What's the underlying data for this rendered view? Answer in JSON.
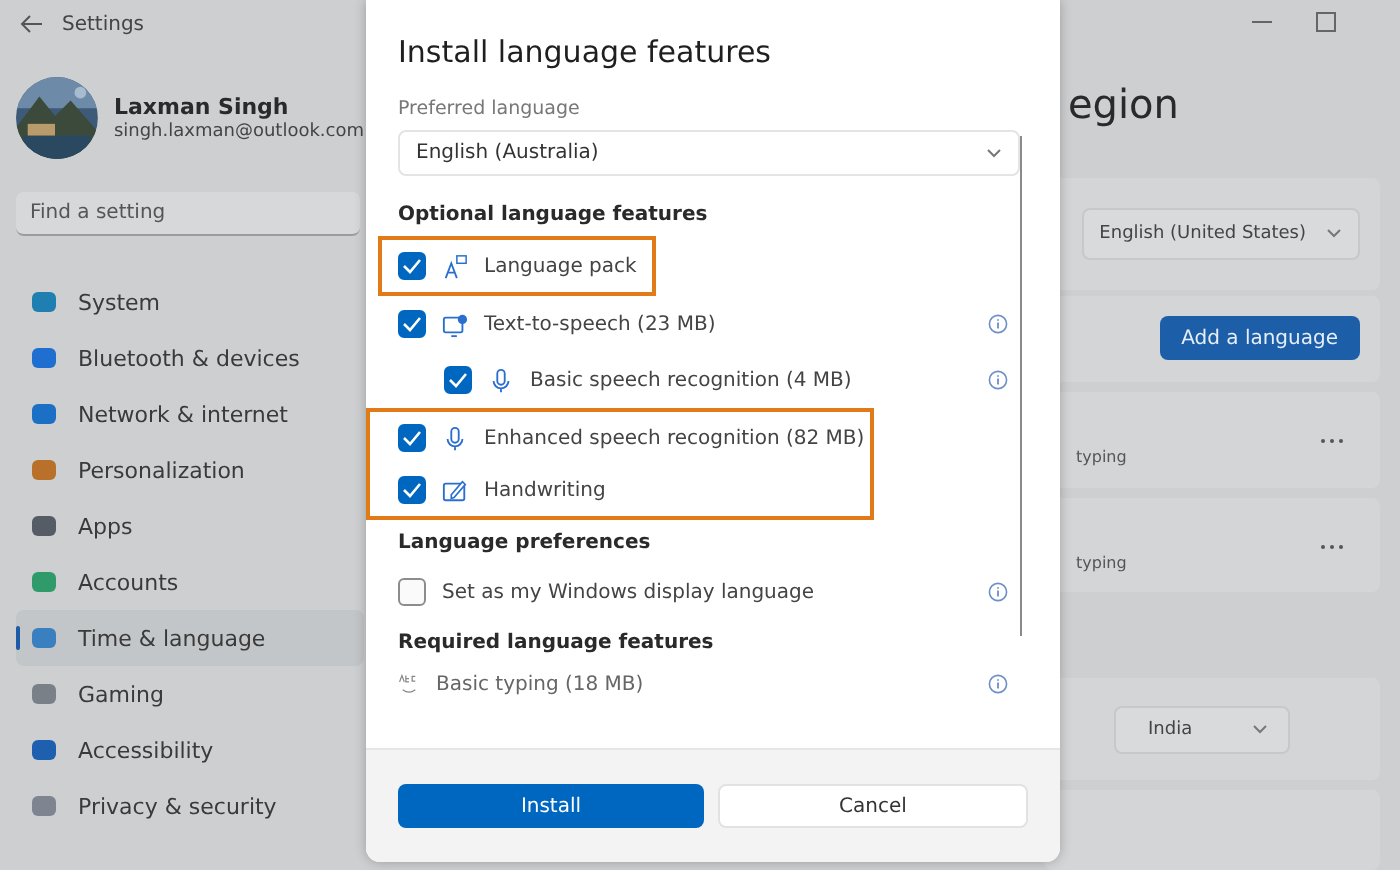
{
  "settings": {
    "title": "Settings",
    "user": {
      "name": "Laxman Singh",
      "email": "singh.laxman@outlook.com"
    },
    "search": {
      "placeholder": "Find a setting"
    },
    "nav": [
      {
        "label": "System",
        "selected": false
      },
      {
        "label": "Bluetooth & devices",
        "selected": false
      },
      {
        "label": "Network & internet",
        "selected": false
      },
      {
        "label": "Personalization",
        "selected": false
      },
      {
        "label": "Apps",
        "selected": false
      },
      {
        "label": "Accounts",
        "selected": false
      },
      {
        "label": "Time & language",
        "selected": true
      },
      {
        "label": "Gaming",
        "selected": false
      },
      {
        "label": "Accessibility",
        "selected": false
      },
      {
        "label": "Privacy & security",
        "selected": false
      }
    ],
    "page_title": "egion",
    "language_dropdown": "English (United States)",
    "add_button": "Add a language",
    "languages": [
      {
        "detail": "typing"
      },
      {
        "detail": "typing"
      }
    ],
    "region_dropdown": "India"
  },
  "dialog": {
    "title": "Install language features",
    "preferred_label": "Preferred language",
    "preferred_value": "English (Australia)",
    "optional_heading": "Optional language features",
    "features": [
      {
        "label": "Language pack",
        "checked": true,
        "highlighted": true
      },
      {
        "label": "Text-to-speech (23 MB)",
        "checked": true,
        "highlighted": false,
        "children": [
          {
            "label": "Basic speech recognition (4 MB)",
            "checked": true
          }
        ]
      },
      {
        "label": "Enhanced speech recognition (82 MB)",
        "checked": true,
        "highlighted": true
      },
      {
        "label": "Handwriting",
        "checked": true,
        "highlighted": true
      }
    ],
    "preferences_heading": "Language preferences",
    "preferences": [
      {
        "label": "Set as my Windows display language",
        "checked": false
      }
    ],
    "required_heading": "Required language features",
    "required": [
      {
        "label": "Basic typing (18 MB)"
      }
    ],
    "buttons": [
      {
        "label": "Install",
        "kind": "primary"
      },
      {
        "label": "Cancel",
        "kind": "secondary"
      }
    ]
  }
}
